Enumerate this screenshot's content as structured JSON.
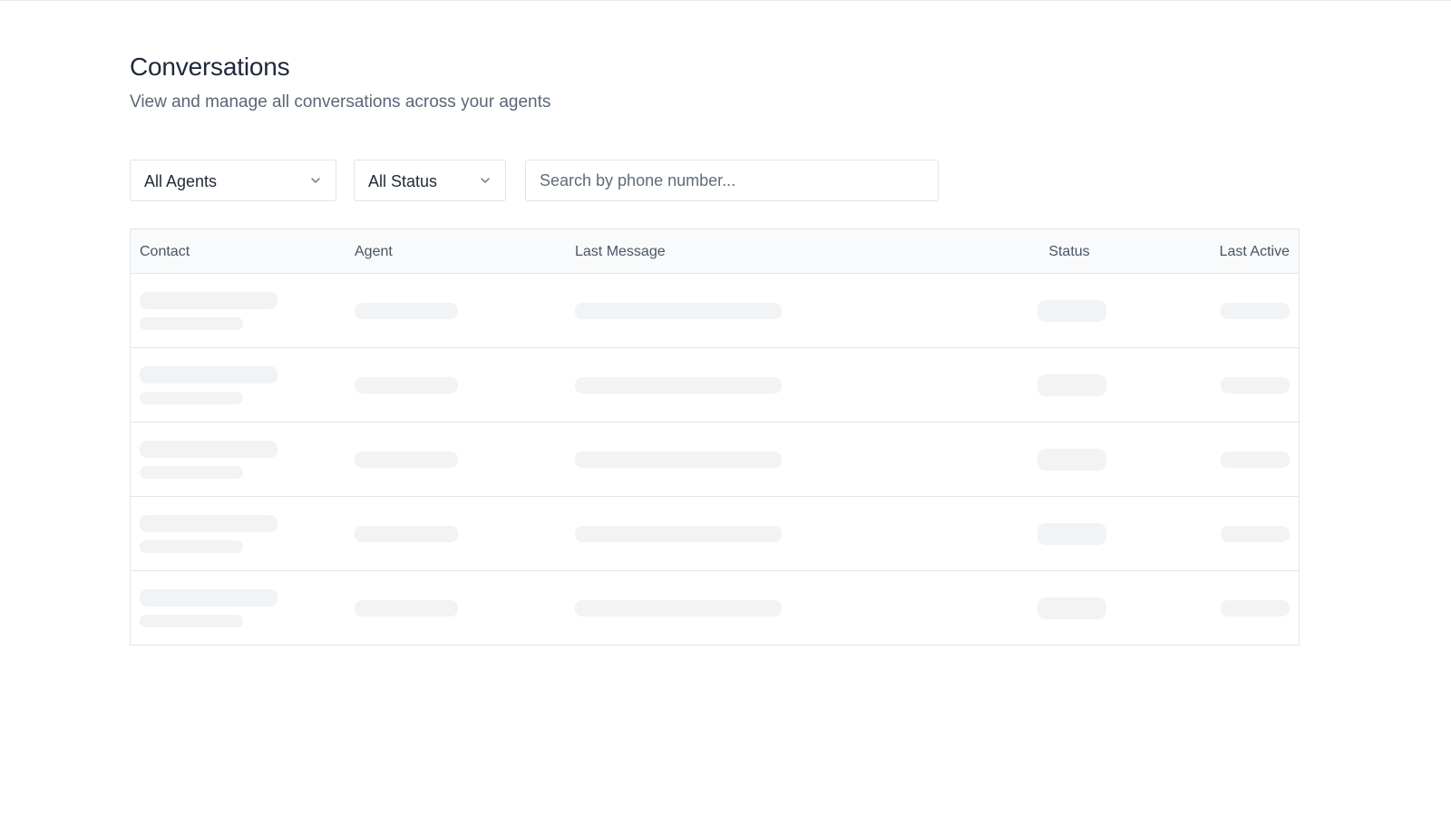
{
  "header": {
    "title": "Conversations",
    "subtitle": "View and manage all conversations across your agents"
  },
  "filters": {
    "agent_select": {
      "value": "All Agents",
      "icon": "chevron-down-icon"
    },
    "status_select": {
      "value": "All Status",
      "icon": "chevron-down-icon"
    },
    "search": {
      "value": "",
      "placeholder": "Search by phone number..."
    }
  },
  "table": {
    "columns": [
      "Contact",
      "Agent",
      "Last Message",
      "Status",
      "Last Active"
    ],
    "loading": true
  },
  "colors": {
    "skeleton": "#f1f3f5",
    "border": "#e2e6ea",
    "header_bg": "#f8fafb"
  }
}
